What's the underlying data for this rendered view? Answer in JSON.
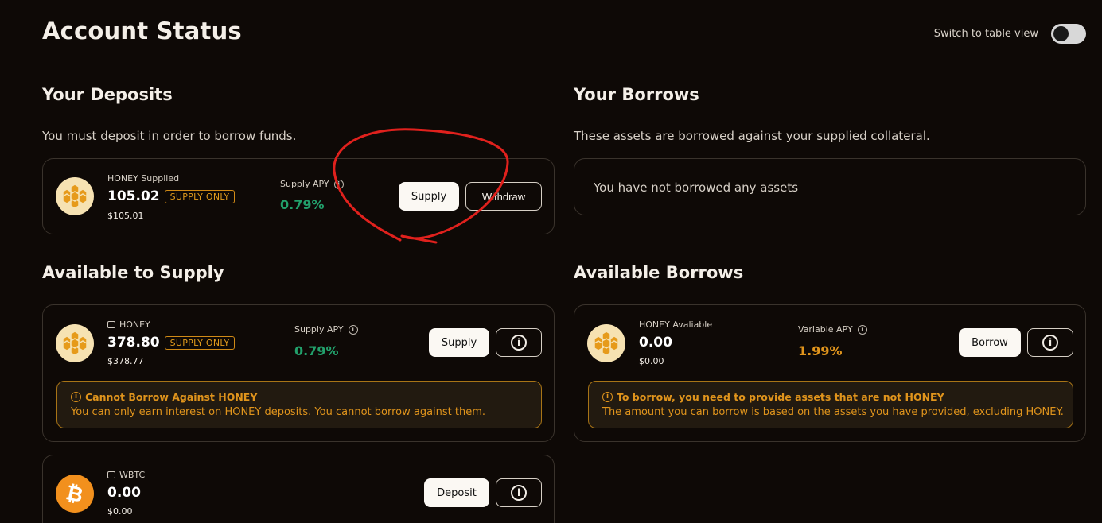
{
  "header": {
    "title": "Account Status",
    "toggle_label": "Switch to table view",
    "toggle_on": false
  },
  "deposits": {
    "title": "Your Deposits",
    "subtitle": "You must deposit in order to borrow funds.",
    "item": {
      "icon": "honey-icon",
      "label": "HONEY Supplied",
      "amount": "105.02",
      "badge": "SUPPLY ONLY",
      "usd": "$105.01",
      "apy_label": "Supply APY",
      "apy": "0.79%",
      "supply_btn": "Supply",
      "withdraw_btn": "Withdraw"
    }
  },
  "borrows": {
    "title": "Your Borrows",
    "subtitle": "These assets are borrowed against your supplied collateral.",
    "empty": "You have not borrowed any assets"
  },
  "available_supply": {
    "title": "Available to Supply",
    "honey": {
      "icon": "honey-icon",
      "label": "HONEY",
      "amount": "378.80",
      "badge": "SUPPLY ONLY",
      "usd": "$378.77",
      "apy_label": "Supply APY",
      "apy": "0.79%",
      "supply_btn": "Supply",
      "warning_title": "Cannot Borrow Against HONEY",
      "warning_text": "You can only earn interest on HONEY deposits. You cannot borrow against them."
    },
    "wbtc": {
      "icon": "bitcoin-icon",
      "label": "WBTC",
      "amount": "0.00",
      "usd": "$0.00",
      "deposit_btn": "Deposit"
    }
  },
  "available_borrows": {
    "title": "Available Borrows",
    "honey": {
      "icon": "honey-icon",
      "label": "HONEY Avaliable",
      "amount": "0.00",
      "usd": "$0.00",
      "apy_label": "Variable APY",
      "apy": "1.99%",
      "borrow_btn": "Borrow",
      "warning_title": "To borrow, you need to provide assets that are not HONEY",
      "warning_text": "The amount you can borrow is based on the assets you have provided, excluding HONEY."
    }
  },
  "colors": {
    "accent_green": "#22a06b",
    "accent_orange": "#e0941c",
    "annotation_red": "#e0211d"
  }
}
